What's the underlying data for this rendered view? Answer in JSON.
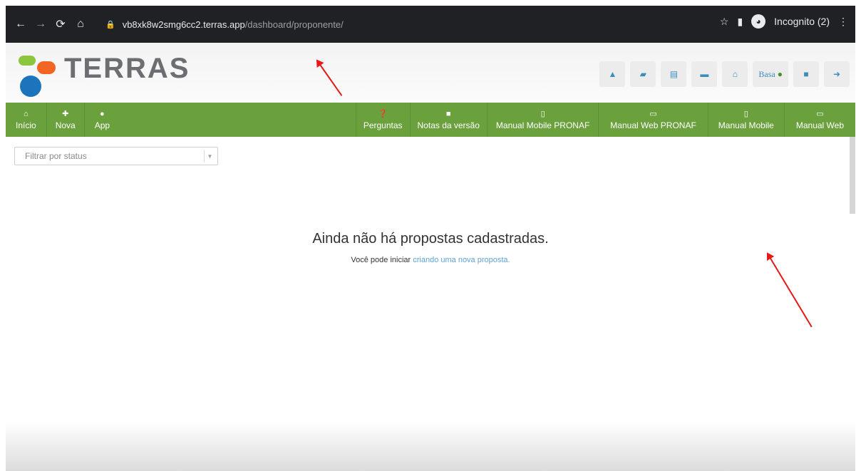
{
  "browser": {
    "back_icon": "arrow-left",
    "forward_icon": "arrow-right",
    "reload_icon": "reload",
    "home_icon": "home",
    "url_host": "vb8xk8w2smg6cc2.terras.app",
    "url_path": "/dashboard/proponente/",
    "incognito_label": "Incognito (2)"
  },
  "header": {
    "logo_text": "TERRAS",
    "basa_label": "Basa",
    "icons": [
      "bell-icon",
      "book-icon",
      "list-icon",
      "briefcase-icon",
      "bank-icon",
      "user-icon",
      "lock-icon",
      "signout-icon"
    ]
  },
  "nav": {
    "left": [
      {
        "label": "Início",
        "icon": "home"
      },
      {
        "label": "Nova",
        "icon": "plus"
      },
      {
        "label": "App",
        "icon": "android"
      }
    ],
    "right": [
      {
        "label": "Perguntas",
        "icon": "question"
      },
      {
        "label": "Notas da versão",
        "icon": "note"
      },
      {
        "label": "Manual Mobile PRONAF",
        "icon": "mobile"
      },
      {
        "label": "Manual Web PRONAF",
        "icon": "desktop"
      },
      {
        "label": "Manual Mobile",
        "icon": "mobile"
      },
      {
        "label": "Manual Web",
        "icon": "desktop"
      }
    ]
  },
  "filter": {
    "placeholder": "Filtrar por status"
  },
  "empty_state": {
    "title": "Ainda não há propostas cadastradas.",
    "prefix": "Você pode iniciar",
    "link": "criando uma nova proposta."
  },
  "colors": {
    "nav_green": "#6aa13d",
    "link_blue": "#5fa2d6",
    "annotation_red": "#e61919"
  }
}
